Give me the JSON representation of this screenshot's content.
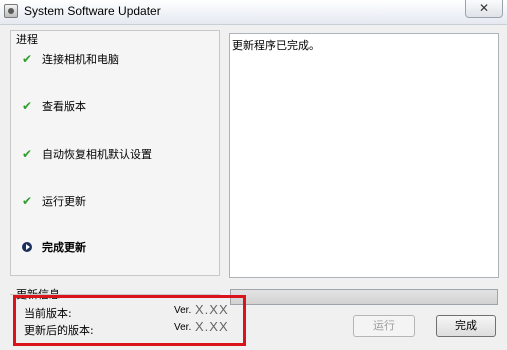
{
  "window": {
    "title": "System Software Updater",
    "close_label": "✕"
  },
  "progress_group": {
    "label": "进程",
    "steps": [
      {
        "label": "连接相机和电脑",
        "status": "done"
      },
      {
        "label": "查看版本",
        "status": "done"
      },
      {
        "label": "自动恢复相机默认设置",
        "status": "done"
      },
      {
        "label": "运行更新",
        "status": "done"
      },
      {
        "label": "完成更新",
        "status": "current"
      }
    ]
  },
  "log": {
    "text": "更新程序已完成。"
  },
  "update_info": {
    "label": "更新信息",
    "current_version_label": "当前版本:",
    "current_version_prefix": "Ver.",
    "current_version_value": "X.XX",
    "updated_version_label": "更新后的版本:",
    "updated_version_prefix": "Ver.",
    "updated_version_value": "X.XX"
  },
  "progress_bar": {
    "fraction": 0.0
  },
  "buttons": {
    "run_label": "运行",
    "finish_label": "完成"
  },
  "colors": {
    "highlight": "#d9141a",
    "check": "#2e9e2e"
  }
}
